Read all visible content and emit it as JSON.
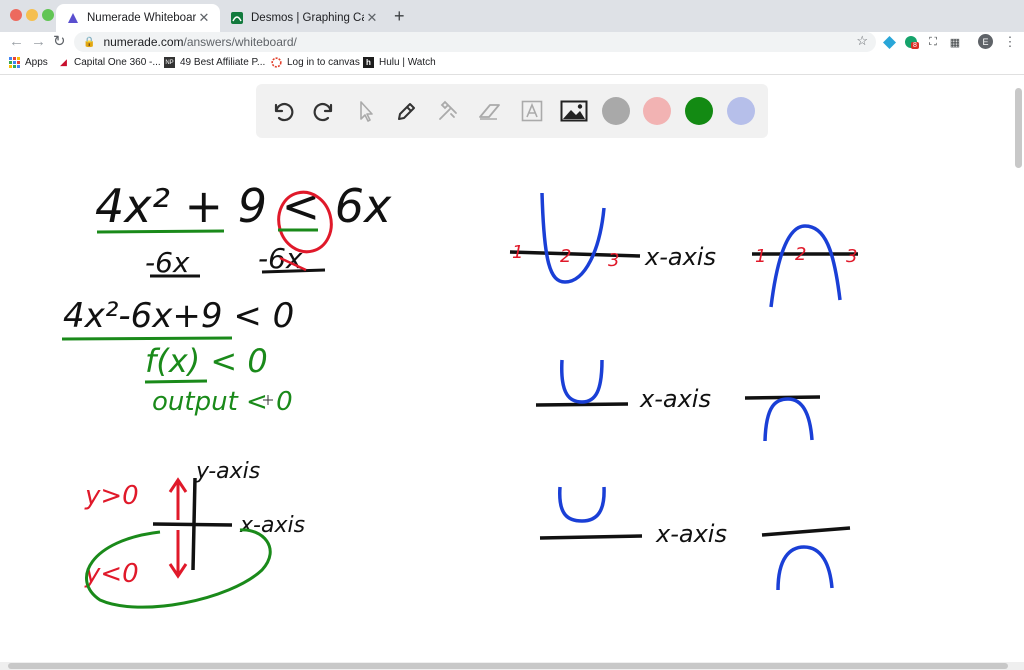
{
  "browser": {
    "tabs": [
      {
        "title": "Numerade Whiteboard",
        "active": true
      },
      {
        "title": "Desmos | Graphing Calculator",
        "active": false
      }
    ],
    "new_tab": "+",
    "url_host": "numerade.com",
    "url_path": "/answers/whiteboard/",
    "profile_initial": "E",
    "extension_badge": "8"
  },
  "bookmarks": [
    {
      "label": "Apps",
      "icon": "apps-grid-icon"
    },
    {
      "label": "Capital One 360 -...",
      "icon": "capital-one-icon"
    },
    {
      "label": "49 Best Affiliate P...",
      "icon": "np-icon"
    },
    {
      "label": "Log in to canvas",
      "icon": "canvas-icon"
    },
    {
      "label": "Hulu | Watch",
      "icon": "hulu-icon"
    }
  ],
  "whiteboard": {
    "tools": [
      "undo-icon",
      "redo-icon",
      "pointer-icon",
      "pen-icon",
      "tools-icon",
      "eraser-icon",
      "text-icon",
      "image-icon"
    ],
    "colors": [
      {
        "name": "gray",
        "hex": "#a9a9a9"
      },
      {
        "name": "pink",
        "hex": "#f2b3b3"
      },
      {
        "name": "green",
        "hex": "#138a13",
        "selected": true
      },
      {
        "name": "lavender",
        "hex": "#b6bfea"
      }
    ],
    "handwriting": {
      "line1": "4x² + 9 < 6x",
      "line2_left": "-6x",
      "line2_right": "-6x",
      "line3": "4x²-6x+9 < 0",
      "line4": "f(x)  < 0",
      "line5": "output < 0",
      "y_axis": "y-axis",
      "x_axis_label": "x-axis",
      "y_gt": "y>0",
      "y_lt": "y<0",
      "graph_label_1": "x-axis",
      "graph_label_2": "x-axis",
      "graph_label_3": "x-axis",
      "tick_1": "1",
      "tick_2": "2",
      "tick_3": "3"
    },
    "ink_colors": {
      "black": "#111111",
      "green": "#1a8a1a",
      "red": "#e0192a",
      "blue": "#1a3fd6"
    }
  }
}
